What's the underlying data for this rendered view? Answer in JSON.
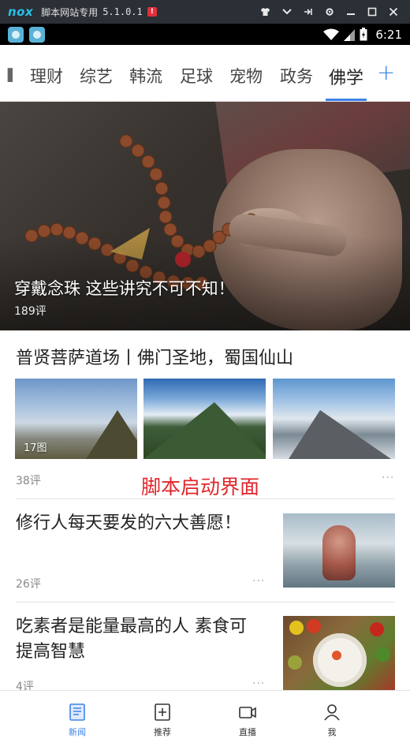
{
  "emulator": {
    "logo": "nox",
    "title": "脚本网站专用",
    "version": "5.1.0.1",
    "badge": "!",
    "controls": [
      "shirt-icon",
      "chevron-down-icon",
      "pin-icon",
      "gear-icon",
      "minimize-icon",
      "maximize-icon",
      "close-icon"
    ]
  },
  "status_bar": {
    "time": "6:21",
    "icons": [
      "app-notification-icon",
      "app-notification-icon",
      "wifi-icon",
      "signal-icon",
      "battery-icon"
    ]
  },
  "tabs": {
    "items": [
      "理财",
      "综艺",
      "韩流",
      "足球",
      "宠物",
      "政务",
      "佛学"
    ],
    "active": "佛学",
    "add_label": "+"
  },
  "hero": {
    "title": "穿戴念珠 这些讲究不可不知！",
    "comments": "189评"
  },
  "gallery": {
    "title": "普贤菩萨道场丨佛门圣地，蜀国仙山",
    "photo_count": "17图",
    "comments": "38评",
    "more": "···"
  },
  "overlay": {
    "text": "脚本启动界面",
    "color": "#e0262c"
  },
  "articles": [
    {
      "title": "修行人每天要发的六大善愿！",
      "comments": "26评",
      "more": "···"
    },
    {
      "title": "吃素者是能量最高的人 素食可提高智慧",
      "comments": "4评",
      "more": "···"
    }
  ],
  "bottom_nav": {
    "items": [
      {
        "label": "新闻",
        "icon": "news-icon",
        "active": true
      },
      {
        "label": "推荐",
        "icon": "add-square-icon",
        "active": false
      },
      {
        "label": "直播",
        "icon": "video-icon",
        "active": false
      },
      {
        "label": "我",
        "icon": "profile-icon",
        "active": false
      }
    ],
    "accent": "#3d83e8"
  }
}
